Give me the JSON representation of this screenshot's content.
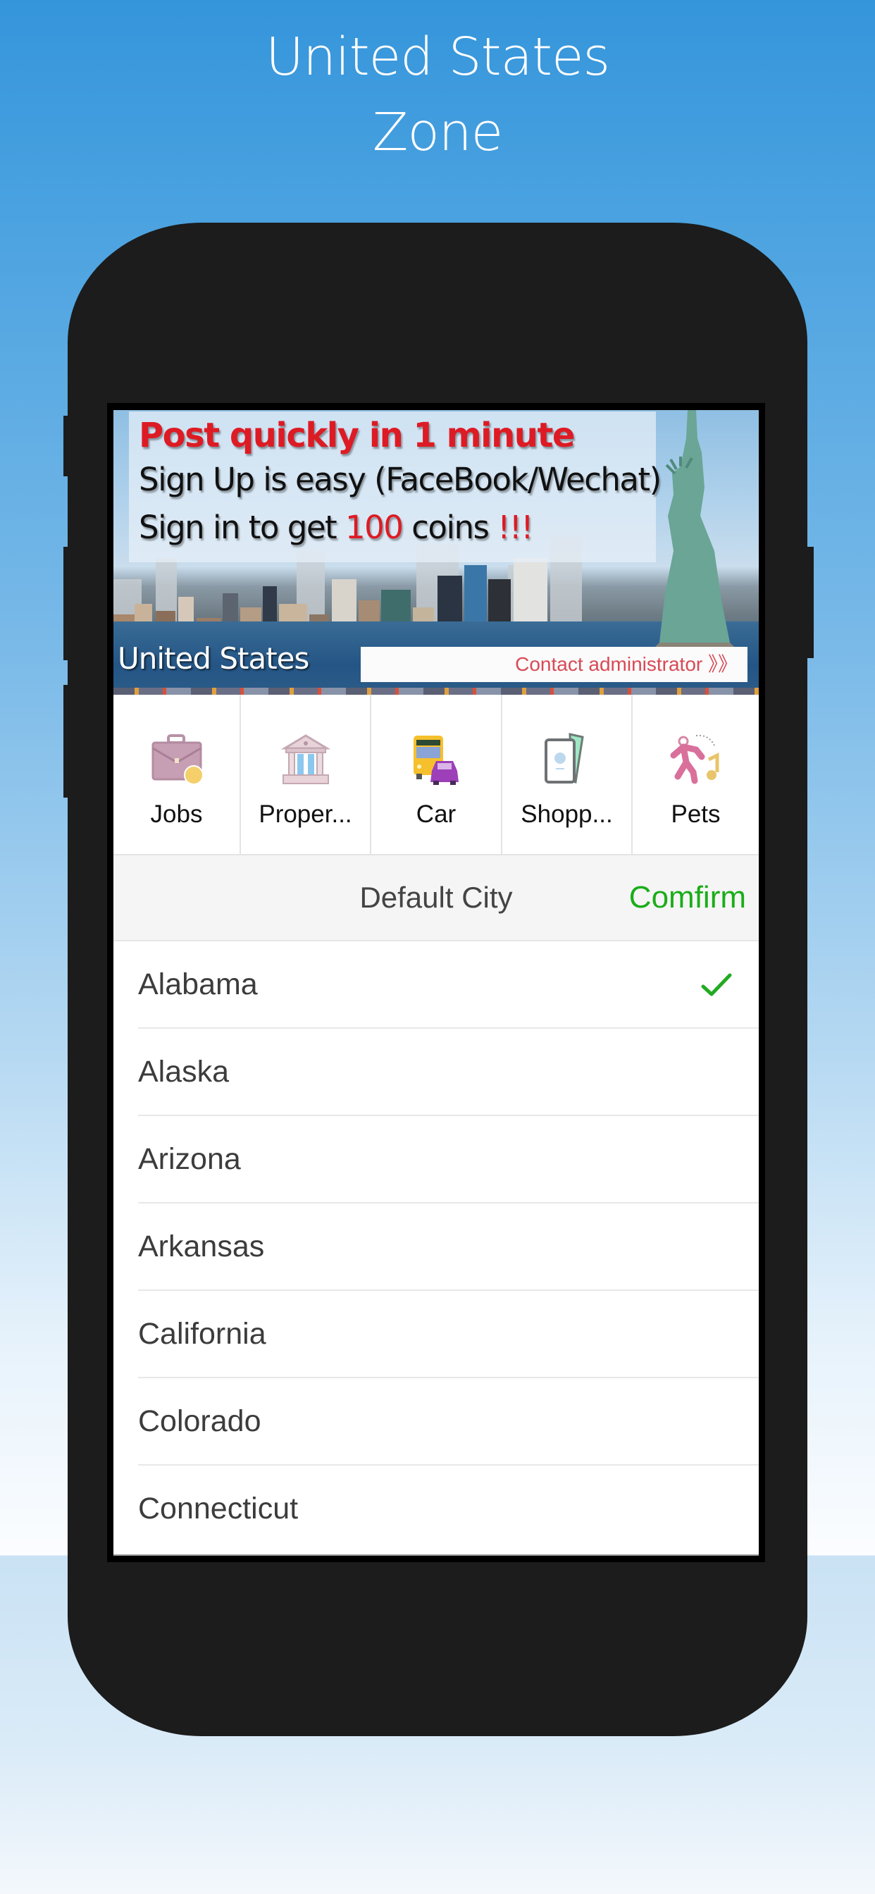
{
  "page": {
    "title_line1": "United States",
    "title_line2": "Zone"
  },
  "banner": {
    "headline": "Post quickly in 1 minute",
    "line2": "Sign Up is easy (FaceBook/Wechat)",
    "line3_prefix": "Sign in to get ",
    "line3_coins": "100",
    "line3_suffix": " coins ",
    "line3_exclaim": "!!!",
    "country": "United States",
    "contact_button": "Contact administrator 》》"
  },
  "categories": [
    {
      "label": "Jobs",
      "icon": "briefcase-icon"
    },
    {
      "label": "Proper...",
      "icon": "bank-building-icon"
    },
    {
      "label": "Car",
      "icon": "car-bus-icon"
    },
    {
      "label": "Shopp...",
      "icon": "shopping-cards-icon"
    },
    {
      "label": "Pets",
      "icon": "dancing-pet-icon"
    }
  ],
  "picker": {
    "title": "Default City",
    "confirm_label": "Comfirm",
    "selected": "Alabama",
    "states": [
      "Alabama",
      "Alaska",
      "Arizona",
      "Arkansas",
      "California",
      "Colorado",
      "Connecticut"
    ]
  },
  "colors": {
    "accent_green": "#1aad19",
    "promo_red": "#dd1b24",
    "contact_red": "#d84a55",
    "phone_body": "#1c1c1c",
    "background_top": "#3595db"
  }
}
